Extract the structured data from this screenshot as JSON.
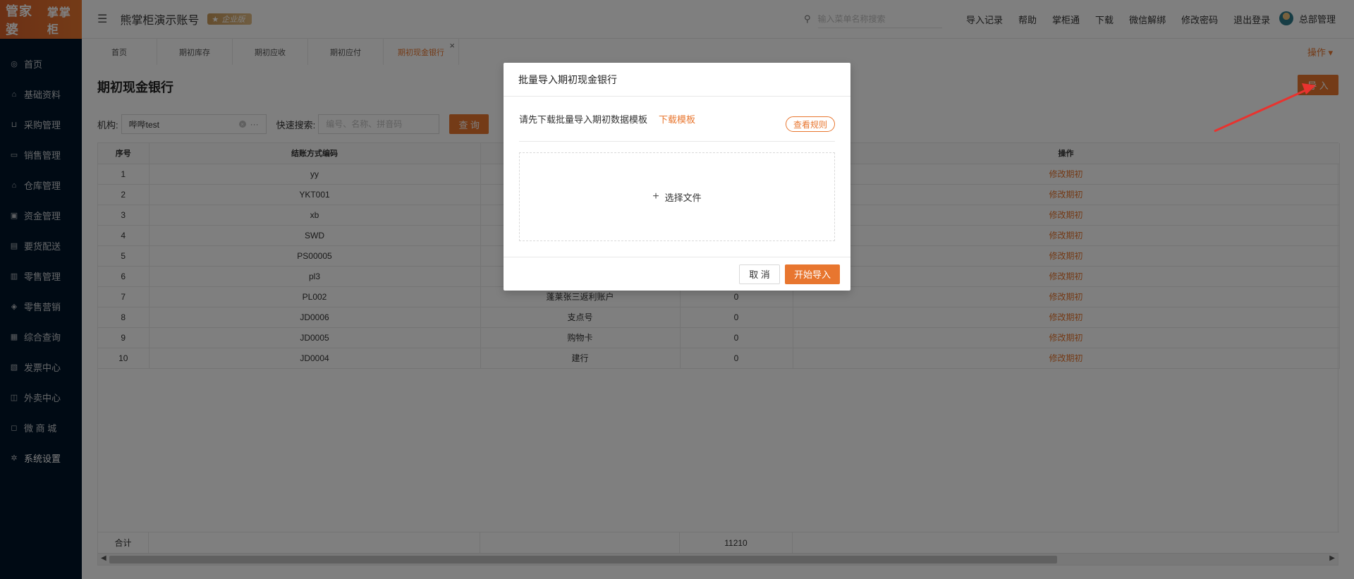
{
  "sidebar": {
    "logo_main": "管家婆",
    "logo_sub": "掌掌柜",
    "items": [
      {
        "label": "首页",
        "icon": "globe-icon",
        "glyph": "◎"
      },
      {
        "label": "基础资料",
        "icon": "home-icon",
        "glyph": "⌂"
      },
      {
        "label": "采购管理",
        "icon": "cart-icon",
        "glyph": "⊔"
      },
      {
        "label": "销售管理",
        "icon": "sales-icon",
        "glyph": "▭"
      },
      {
        "label": "仓库管理",
        "icon": "warehouse-icon",
        "glyph": "⌂"
      },
      {
        "label": "资金管理",
        "icon": "fund-icon",
        "glyph": "▣"
      },
      {
        "label": "要货配送",
        "icon": "delivery-icon",
        "glyph": "▤"
      },
      {
        "label": "零售管理",
        "icon": "retail-chart-icon",
        "glyph": "▥"
      },
      {
        "label": "零售营销",
        "icon": "marketing-icon",
        "glyph": "◈"
      },
      {
        "label": "综合查询",
        "icon": "query-chart-icon",
        "glyph": "▦"
      },
      {
        "label": "发票中心",
        "icon": "invoice-icon",
        "glyph": "▧"
      },
      {
        "label": "外卖中心",
        "icon": "takeout-icon",
        "glyph": "◫"
      },
      {
        "label": "微 商 城",
        "icon": "shop-bag-icon",
        "glyph": "◻"
      },
      {
        "label": "系统设置",
        "icon": "gear-icon",
        "glyph": "✲"
      }
    ]
  },
  "header": {
    "title": "熊掌柜演示账号",
    "badge": "企业版",
    "search_placeholder": "输入菜单名称搜索",
    "links": [
      "导入记录",
      "帮助",
      "掌柜通",
      "下载",
      "微信解绑",
      "修改密码",
      "退出登录"
    ],
    "user": "总部管理"
  },
  "tabs": {
    "items": [
      "首页",
      "期初库存",
      "期初应收",
      "期初应付",
      "期初现金银行"
    ],
    "active_index": 4,
    "ops_label": "操作 ▾"
  },
  "page": {
    "title": "期初现金银行",
    "import_label": "导 入",
    "org_label": "机构:",
    "org_value": "哔哔test",
    "quick_label": "快速搜索:",
    "quick_placeholder": "编号、名称、拼音码",
    "query_label": "查 询"
  },
  "table": {
    "headers": [
      "序号",
      "结账方式编码",
      "",
      "",
      "操作"
    ],
    "rows": [
      {
        "no": "1",
        "code": "yy",
        "name": "",
        "amount": "",
        "op": "修改期初"
      },
      {
        "no": "2",
        "code": "YKT001",
        "name": "",
        "amount": "",
        "op": "修改期初"
      },
      {
        "no": "3",
        "code": "xb",
        "name": "",
        "amount": "",
        "op": "修改期初"
      },
      {
        "no": "4",
        "code": "SWD",
        "name": "",
        "amount": "",
        "op": "修改期初"
      },
      {
        "no": "5",
        "code": "PS00005",
        "name": "",
        "amount": "",
        "op": "修改期初"
      },
      {
        "no": "6",
        "code": "pl3",
        "name": "",
        "amount": "",
        "op": "修改期初"
      },
      {
        "no": "7",
        "code": "PL002",
        "name": "蓬莱张三返利账户",
        "amount": "0",
        "op": "修改期初"
      },
      {
        "no": "8",
        "code": "JD0006",
        "name": "支点号",
        "amount": "0",
        "op": "修改期初"
      },
      {
        "no": "9",
        "code": "JD0005",
        "name": "购物卡",
        "amount": "0",
        "op": "修改期初"
      },
      {
        "no": "10",
        "code": "JD0004",
        "name": "建行",
        "amount": "0",
        "op": "修改期初"
      }
    ],
    "total_label": "合计",
    "total_amount": "11210"
  },
  "modal": {
    "title": "批量导入期初现金银行",
    "hint": "请先下载批量导入期初数据模板",
    "download_label": "下载模板",
    "rules_label": "查看规则",
    "upload_label": "选择文件",
    "cancel_label": "取 消",
    "start_label": "开始导入"
  },
  "colors": {
    "accent": "#e8762f",
    "sidebar_bg": "#001529",
    "annotation_arrow": "#e8332f"
  }
}
